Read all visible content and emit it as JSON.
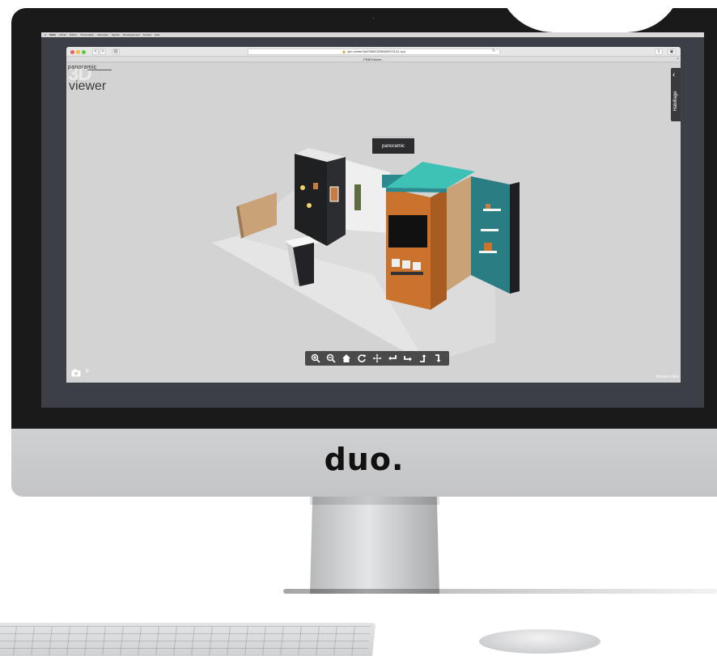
{
  "mac_menubar": {
    "items": [
      "Safari",
      "Fichier",
      "Édition",
      "Présentation",
      "Historique",
      "Signets",
      "Développement",
      "Fenêtre",
      "Aide"
    ]
  },
  "browser": {
    "url": "xpo.center/3d/00BDCB0B059C0141-xpo",
    "tab_title": "P53DViewer -",
    "back_label": "<",
    "forward_label": ">"
  },
  "viewer": {
    "logo_top": "panoramic",
    "logo_3d": "3D",
    "logo_bottom": "viewer",
    "side_panel_label": "Habillage",
    "sign_text": "panoramic",
    "lang_label": "fr",
    "version_label": "Version Libre",
    "controls": [
      "zoom-in",
      "zoom-out",
      "home",
      "rotate",
      "move",
      "turn-left",
      "turn-right",
      "tilt-up",
      "tilt-down"
    ]
  },
  "brand": {
    "name": "duo."
  },
  "colors": {
    "bezel": "#1a1a1a",
    "viewer_bg": "#d3d3d3",
    "orange": "#c9732d",
    "teal": "#2a8a8f",
    "teal_roof": "#3fc2b6",
    "dark_panel": "#1e1f22"
  }
}
